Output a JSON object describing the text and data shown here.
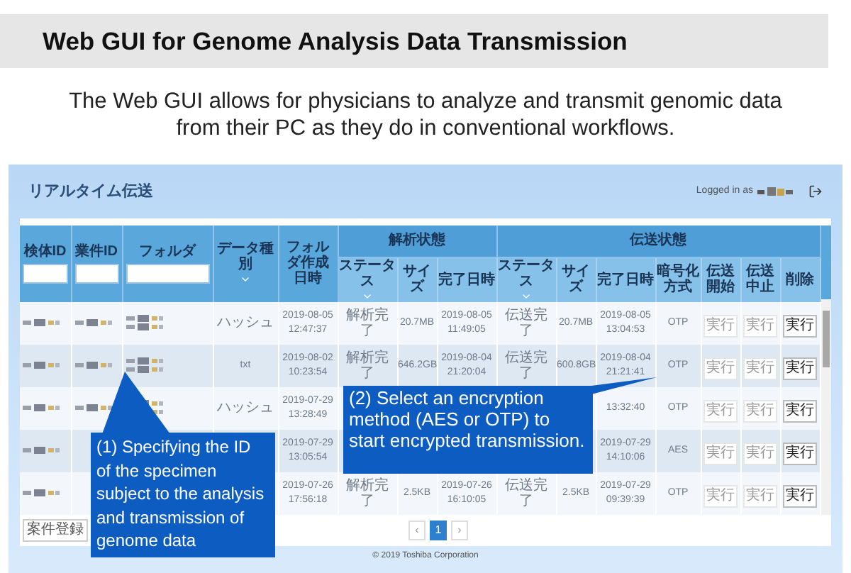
{
  "slide": {
    "title": "Web GUI for Genome Analysis Data Transmission",
    "description": "The Web GUI allows for physicians to analyze and transmit genomic data from their PC as they do in conventional workflows."
  },
  "app": {
    "title": "リアルタイム伝送",
    "login_label": "Logged in as",
    "footer": "© 2019 Toshiba Corporation"
  },
  "table": {
    "columns": [
      {
        "label": "検体ID",
        "filter": true
      },
      {
        "label": "業件ID",
        "filter": true
      },
      {
        "label": "フォルダ",
        "filter": true
      },
      {
        "label": "データ種別",
        "sortable": true
      },
      {
        "label": "フォルダ作成日時"
      }
    ],
    "groups": [
      {
        "label": "解析状態",
        "columns": [
          {
            "label": "ステータス",
            "sortable": true
          },
          {
            "label": "サイズ"
          },
          {
            "label": "完了日時"
          }
        ]
      },
      {
        "label": "伝送状態",
        "columns": [
          {
            "label": "ステータス",
            "sortable": true
          },
          {
            "label": "サイズ"
          },
          {
            "label": "完了日時"
          },
          {
            "label": "暗号化方式"
          },
          {
            "label": "伝送開始"
          },
          {
            "label": "伝送中止"
          },
          {
            "label": "削除"
          }
        ]
      }
    ],
    "rows": [
      {
        "cells": [
          {
            "kind": "redacted"
          },
          {
            "kind": "redacted"
          },
          {
            "kind": "redacted"
          },
          {
            "kind": "text",
            "text": "ハッシュ"
          },
          {
            "kind": "text",
            "text": "2019-08-05 12:47:37"
          },
          {
            "kind": "text",
            "text": "解析完了"
          },
          {
            "kind": "text",
            "text": "20.7MB"
          },
          {
            "kind": "text",
            "text": "2019-08-05 11:49:05"
          },
          {
            "kind": "text",
            "text": "伝送完了"
          },
          {
            "kind": "text",
            "text": "20.7MB"
          },
          {
            "kind": "text",
            "text": "2019-08-05 13:04:53"
          },
          {
            "kind": "text",
            "text": "OTP"
          },
          {
            "kind": "button",
            "label": "実行",
            "disabled": true
          },
          {
            "kind": "button",
            "label": "実行",
            "disabled": true
          },
          {
            "kind": "button",
            "label": "実行",
            "disabled": false
          }
        ]
      },
      {
        "cells": [
          {
            "kind": "redacted"
          },
          {
            "kind": "redacted"
          },
          {
            "kind": "redacted"
          },
          {
            "kind": "text",
            "text": "txt"
          },
          {
            "kind": "text",
            "text": "2019-08-02 10:23:54"
          },
          {
            "kind": "text",
            "text": "解析完了"
          },
          {
            "kind": "text",
            "text": "646.2GB"
          },
          {
            "kind": "text",
            "text": "2019-08-04 21:20:04"
          },
          {
            "kind": "text",
            "text": "伝送完了"
          },
          {
            "kind": "text",
            "text": "600.8GB"
          },
          {
            "kind": "text",
            "text": "2019-08-04 21:21:41"
          },
          {
            "kind": "text",
            "text": "OTP"
          },
          {
            "kind": "button",
            "label": "実行",
            "disabled": true
          },
          {
            "kind": "button",
            "label": "実行",
            "disabled": true
          },
          {
            "kind": "button",
            "label": "実行",
            "disabled": false
          }
        ]
      },
      {
        "cells": [
          {
            "kind": "redacted"
          },
          {
            "kind": "redacted"
          },
          {
            "kind": "redacted"
          },
          {
            "kind": "text",
            "text": "ハッシュ"
          },
          {
            "kind": "text",
            "text": "2019-07-29 13:28:49"
          },
          null,
          null,
          null,
          null,
          null,
          {
            "kind": "text",
            "text": "13:32:40"
          },
          {
            "kind": "text",
            "text": "OTP"
          },
          {
            "kind": "button",
            "label": "実行",
            "disabled": true
          },
          {
            "kind": "button",
            "label": "実行",
            "disabled": true
          },
          {
            "kind": "button",
            "label": "実行",
            "disabled": false
          }
        ]
      },
      {
        "cells": [
          {
            "kind": "redacted"
          },
          null,
          null,
          null,
          {
            "kind": "text",
            "text": "2019-07-29 13:05:54"
          },
          null,
          null,
          null,
          null,
          null,
          {
            "kind": "text",
            "text": "2019-07-29 14:10:06"
          },
          {
            "kind": "text",
            "text": "AES"
          },
          {
            "kind": "button",
            "label": "実行",
            "disabled": true
          },
          {
            "kind": "button",
            "label": "実行",
            "disabled": true
          },
          {
            "kind": "button",
            "label": "実行",
            "disabled": false
          }
        ]
      },
      {
        "cells": [
          {
            "kind": "redacted"
          },
          null,
          null,
          null,
          {
            "kind": "text",
            "text": "2019-07-26 17:56:18"
          },
          {
            "kind": "text",
            "text": "解析完了"
          },
          {
            "kind": "text",
            "text": "2.5KB"
          },
          {
            "kind": "text",
            "text": "2019-07-26 16:10:05"
          },
          {
            "kind": "text",
            "text": "伝送完了"
          },
          {
            "kind": "text",
            "text": "2.5KB"
          },
          {
            "kind": "text",
            "text": "2019-07-29 09:39:39"
          },
          {
            "kind": "text",
            "text": "OTP"
          },
          {
            "kind": "button",
            "label": "実行",
            "disabled": true
          },
          {
            "kind": "button",
            "label": "実行",
            "disabled": true
          },
          {
            "kind": "button",
            "label": "実行",
            "disabled": false
          }
        ]
      }
    ]
  },
  "register_button": "案件登録",
  "pagination": [
    {
      "label": "‹",
      "selected": false
    },
    {
      "label": "1",
      "selected": true
    },
    {
      "label": "›",
      "selected": false
    }
  ],
  "callouts": [
    {
      "text": "(1) Specifying the ID of the specimen subject to the analysis and transmission of genome data"
    },
    {
      "text": "(2) Select an encryption method (AES or OTP) to start encrypted transmission."
    }
  ]
}
